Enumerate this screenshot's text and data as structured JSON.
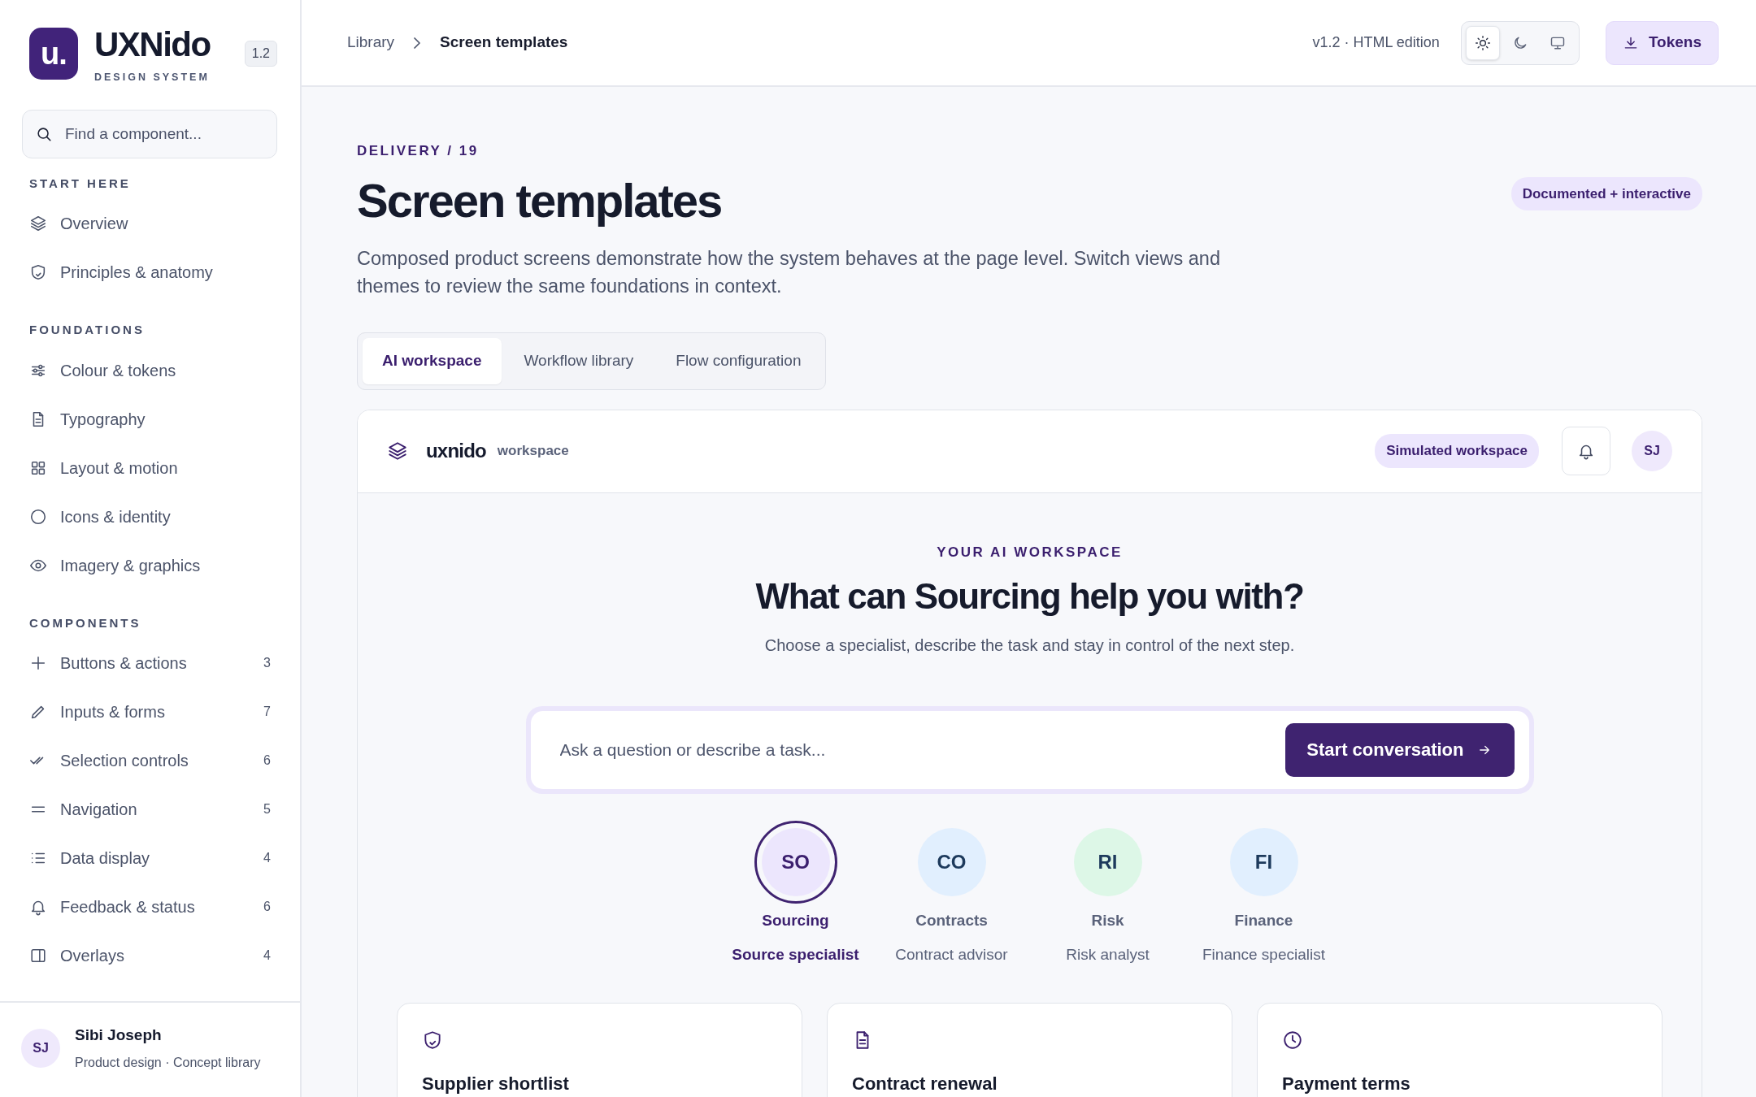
{
  "brand": {
    "logo": "u.",
    "name": "UXNido",
    "tagline": "DESIGN SYSTEM",
    "version": "1.2"
  },
  "search": {
    "placeholder": "Find a component..."
  },
  "sidebar": {
    "sections": [
      {
        "title": "START HERE",
        "items": [
          {
            "label": "Overview"
          },
          {
            "label": "Principles & anatomy"
          }
        ]
      },
      {
        "title": "FOUNDATIONS",
        "items": [
          {
            "label": "Colour & tokens"
          },
          {
            "label": "Typography"
          },
          {
            "label": "Layout & motion"
          },
          {
            "label": "Icons & identity"
          },
          {
            "label": "Imagery & graphics"
          }
        ]
      },
      {
        "title": "COMPONENTS",
        "items": [
          {
            "label": "Buttons & actions",
            "count": "3"
          },
          {
            "label": "Inputs & forms",
            "count": "7"
          },
          {
            "label": "Selection controls",
            "count": "6"
          },
          {
            "label": "Navigation",
            "count": "5"
          },
          {
            "label": "Data display",
            "count": "4"
          },
          {
            "label": "Feedback & status",
            "count": "6"
          },
          {
            "label": "Overlays",
            "count": "4"
          }
        ]
      }
    ]
  },
  "user": {
    "initials": "SJ",
    "name": "Sibi Joseph",
    "role": "Product design · Concept library"
  },
  "breadcrumb": [
    {
      "label": "Library"
    },
    {
      "label": "Screen templates"
    }
  ],
  "edition": "v1.2 · HTML edition",
  "theme_modes": [
    {
      "selected": true
    },
    {
      "selected": false
    },
    {
      "selected": false
    }
  ],
  "tokens_button": "Tokens",
  "page": {
    "eyebrow": "DELIVERY / 19",
    "title": "Screen templates",
    "badge": "Documented + interactive",
    "description": "Composed product screens demonstrate how the system behaves at the page level. Switch views and themes to review the same foundations in context."
  },
  "tabs": [
    {
      "label": "AI workspace",
      "selected": true
    },
    {
      "label": "Workflow library",
      "selected": false
    },
    {
      "label": "Flow configuration",
      "selected": false
    }
  ],
  "workspace": {
    "brand": "uxnido",
    "brand_suffix": "workspace",
    "badge": "Simulated workspace",
    "avatar": "SJ",
    "eyebrow": "YOUR AI WORKSPACE",
    "heading": "What can Sourcing help you with?",
    "subheading": "Choose a specialist, describe the task and stay in control of the next step.",
    "prompt": {
      "placeholder": "Ask a question or describe a task..."
    },
    "start_button": "Start conversation",
    "specialists": [
      {
        "initials": "SO",
        "name": "Sourcing",
        "role": "Source specialist",
        "color": "#ece6fd",
        "selected": true
      },
      {
        "initials": "CO",
        "name": "Contracts",
        "role": "Contract advisor",
        "color": "#e1effe",
        "selected": false
      },
      {
        "initials": "RI",
        "name": "Risk",
        "role": "Risk analyst",
        "color": "#ddf7e7",
        "selected": false
      },
      {
        "initials": "FI",
        "name": "Finance",
        "role": "Finance specialist",
        "color": "#e1effe",
        "selected": false
      }
    ],
    "cards": [
      {
        "title": "Supplier shortlist"
      },
      {
        "title": "Contract renewal"
      },
      {
        "title": "Payment terms"
      }
    ]
  }
}
